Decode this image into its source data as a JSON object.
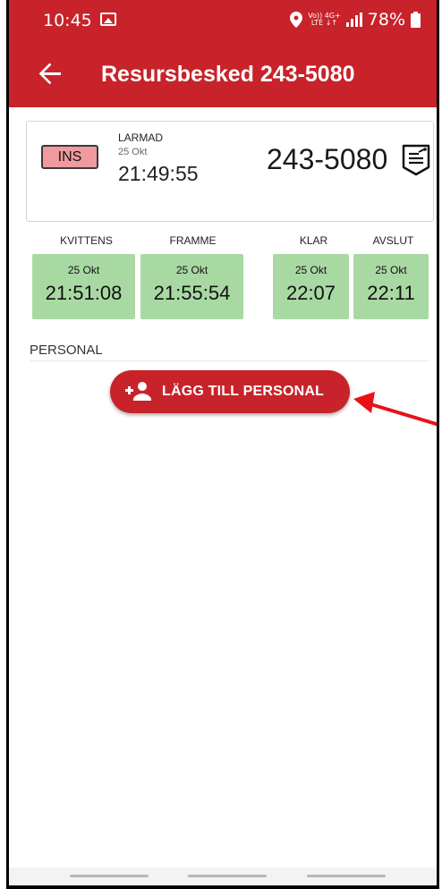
{
  "status_bar": {
    "time": "10:45",
    "network_top": "Vo)) 4G+",
    "network_bottom": "LTE ↓↑",
    "battery": "78%"
  },
  "app_bar": {
    "title": "Resursbesked 243-5080",
    "back_icon": "arrow-left-icon"
  },
  "card": {
    "status_badge": "INS",
    "alarm_label": "LARMAD",
    "alarm_date": "25 Okt",
    "alarm_time": "21:49:55",
    "resource_id": "243-5080",
    "resource_icon": "vehicle-document-icon"
  },
  "timeline": [
    {
      "label": "KVITTENS",
      "date": "25 Okt",
      "time": "21:51:08"
    },
    {
      "label": "FRAMME",
      "date": "25 Okt",
      "time": "21:55:54"
    },
    {
      "label": "KLAR",
      "date": "25 Okt",
      "time": "22:07"
    },
    {
      "label": "AVSLUT",
      "date": "25 Okt",
      "time": "22:11"
    }
  ],
  "personal": {
    "section_title": "PERSONAL",
    "add_button_label": "LÄGG TILL PERSONAL",
    "add_button_icon": "person-add-icon"
  },
  "colors": {
    "primary": "#c8232a",
    "time_box": "#a9d9a3",
    "badge": "#ee9a9f",
    "annotation_arrow": "#e8111a"
  }
}
